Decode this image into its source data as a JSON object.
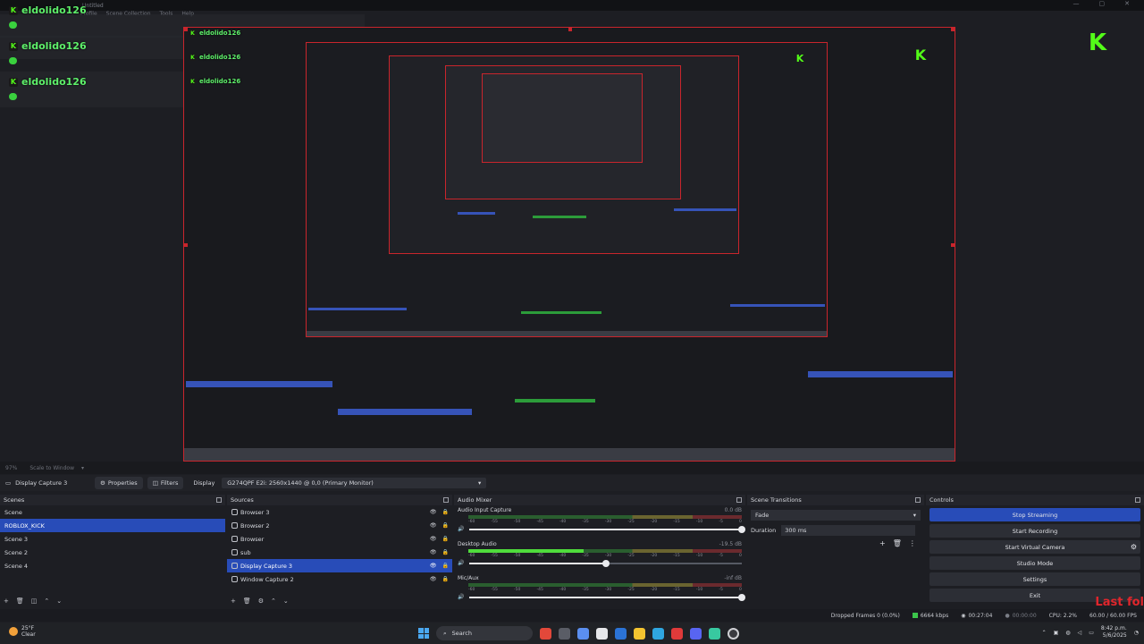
{
  "window": {
    "title": "Untitled",
    "controls": [
      "—",
      "▢",
      "✕"
    ]
  },
  "menu": [
    "Profile",
    "Scene Collection",
    "Tools",
    "Help"
  ],
  "overlay": {
    "chat_username": "eldolido126",
    "last_follower_label": "Last fol"
  },
  "scale_bar": {
    "fps_label": "97%",
    "scale_label": "Scale to Window"
  },
  "toolbar": {
    "source": "Display Capture 3",
    "properties": "Properties",
    "filters": "Filters",
    "display_label": "Display",
    "display_value": "G274QPF E2i: 2560x1440 @ 0,0 (Primary Monitor)"
  },
  "scenes": {
    "title": "Scenes",
    "items": [
      "Scene",
      "ROBLOX_KICK",
      "Scene 3",
      "Scene 2",
      "Scene 4"
    ],
    "selected_index": 1
  },
  "sources": {
    "title": "Sources",
    "items": [
      "Browser 3",
      "Browser 2",
      "Browser",
      "sub",
      "Display Capture 3",
      "Window Capture 2"
    ],
    "selected_index": 4
  },
  "mixer": {
    "title": "Audio Mixer",
    "ticks": [
      "-60",
      "-55",
      "-50",
      "-45",
      "-40",
      "-35",
      "-30",
      "-25",
      "-20",
      "-15",
      "-10",
      "-5",
      "0"
    ],
    "channels": [
      {
        "name": "Audio Input Capture",
        "db": "0.0 dB",
        "level": 0.0,
        "volume": 1.0
      },
      {
        "name": "Desktop Audio",
        "db": "-19.5 dB",
        "level": 0.42,
        "volume": 0.5
      },
      {
        "name": "Mic/Aux",
        "db": "-inf dB",
        "level": 0.0,
        "volume": 1.0
      }
    ]
  },
  "transitions": {
    "title": "Scene Transitions",
    "selected": "Fade",
    "duration_label": "Duration",
    "duration_value": "300 ms"
  },
  "controls": {
    "title": "Controls",
    "buttons": [
      "Stop Streaming",
      "Start Recording",
      "Start Virtual Camera",
      "Studio Mode",
      "Settings",
      "Exit"
    ]
  },
  "status": {
    "dropped": "Dropped Frames 0 (0.0%)",
    "kbps": "6664 kbps",
    "stream_time": "00:27:04",
    "rec_time": "00:00:00",
    "cpu": "CPU: 2.2%",
    "fps": "60.00 / 60.00 FPS"
  },
  "taskbar": {
    "temp": "25°F",
    "weather": "Clear",
    "search": "Search",
    "time": "8:42 p.m.",
    "date": "5/6/2025"
  },
  "colors": {
    "accent": "#284cb8",
    "kick_green": "#53fc18",
    "selection_red": "#c9252c"
  }
}
